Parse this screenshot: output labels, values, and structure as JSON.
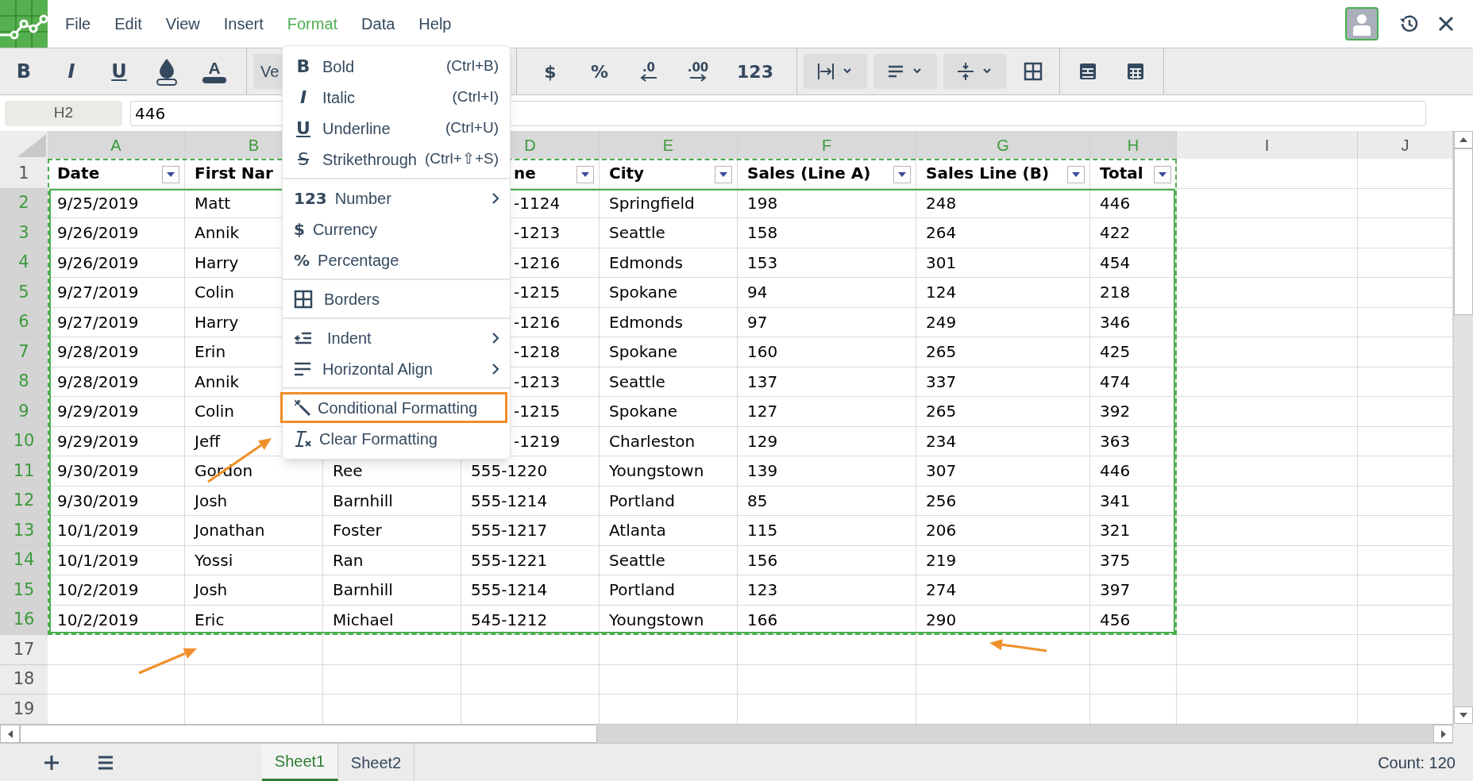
{
  "app_menu": [
    {
      "label": "File",
      "selected": false
    },
    {
      "label": "Edit",
      "selected": false
    },
    {
      "label": "View",
      "selected": false
    },
    {
      "label": "Insert",
      "selected": false
    },
    {
      "label": "Format",
      "selected": true
    },
    {
      "label": "Data",
      "selected": false
    },
    {
      "label": "Help",
      "selected": false
    }
  ],
  "toolbar": {
    "style_buttons": [
      {
        "kind": "bold",
        "label": "B"
      },
      {
        "kind": "italic",
        "label": "I"
      },
      {
        "kind": "underline",
        "label": "U"
      },
      {
        "kind": "fill"
      },
      {
        "kind": "font_color",
        "label": "A"
      }
    ],
    "font_select": "Ve",
    "number_buttons": [
      {
        "kind": "glyph",
        "label": "$"
      },
      {
        "kind": "glyph",
        "label": "%"
      },
      {
        "kind": "decrease",
        "label": ".0"
      },
      {
        "kind": "increase",
        "label": ".00"
      },
      {
        "kind": "glyph",
        "label": "123"
      }
    ]
  },
  "formula_bar": {
    "cell_name": "H2",
    "value": "446"
  },
  "columns": [
    {
      "letter": "A",
      "selected": true
    },
    {
      "letter": "B",
      "selected": true
    },
    {},
    {
      "letter": "D",
      "selected": true
    },
    {
      "letter": "E",
      "selected": true
    },
    {
      "letter": "F",
      "selected": true
    },
    {
      "letter": "G",
      "selected": true
    },
    {
      "letter": "H",
      "selected": true
    },
    {
      "letter": "I",
      "selected": false
    },
    {
      "letter": "J",
      "selected": false
    }
  ],
  "header_row": {
    "number": "1",
    "cells": {
      "A": {
        "text": "Date",
        "filter": true
      },
      "B": {
        "text": "First Nar",
        "filter": false
      },
      "D": {
        "text": "ne",
        "filter": true
      },
      "E": {
        "text": "City",
        "filter": true
      },
      "F": {
        "text": "Sales (Line A)",
        "filter": true
      },
      "G": {
        "text": "Sales Line (B)",
        "filter": true
      },
      "H": {
        "text": "Total",
        "filter": true
      }
    }
  },
  "rows": [
    {
      "number": "2",
      "selected": true,
      "cells": {
        "A": "9/25/2019",
        "B": "Matt",
        "D": "-1124",
        "E": "Springfield",
        "F": "198",
        "G": "248",
        "H": "446"
      }
    },
    {
      "number": "3",
      "selected": true,
      "cells": {
        "A": "9/26/2019",
        "B": "Annik",
        "D": "-1213",
        "E": "Seattle",
        "F": "158",
        "G": "264",
        "H": "422"
      }
    },
    {
      "number": "4",
      "selected": true,
      "cells": {
        "A": "9/26/2019",
        "B": "Harry",
        "D": "-1216",
        "E": "Edmonds",
        "F": "153",
        "G": "301",
        "H": "454"
      }
    },
    {
      "number": "5",
      "selected": true,
      "cells": {
        "A": "9/27/2019",
        "B": "Colin",
        "D": "-1215",
        "E": "Spokane",
        "F": "94",
        "G": "124",
        "H": "218"
      }
    },
    {
      "number": "6",
      "selected": true,
      "cells": {
        "A": "9/27/2019",
        "B": "Harry",
        "D": "-1216",
        "E": "Edmonds",
        "F": "97",
        "G": "249",
        "H": "346"
      }
    },
    {
      "number": "7",
      "selected": true,
      "cells": {
        "A": "9/28/2019",
        "B": "Erin",
        "D": "-1218",
        "E": "Spokane",
        "F": "160",
        "G": "265",
        "H": "425"
      }
    },
    {
      "number": "8",
      "selected": true,
      "cells": {
        "A": "9/28/2019",
        "B": "Annik",
        "D": "-1213",
        "E": "Seattle",
        "F": "137",
        "G": "337",
        "H": "474"
      }
    },
    {
      "number": "9",
      "selected": true,
      "cells": {
        "A": "9/29/2019",
        "B": "Colin",
        "D": "-1215",
        "E": "Spokane",
        "F": "127",
        "G": "265",
        "H": "392"
      }
    },
    {
      "number": "10",
      "selected": true,
      "cells": {
        "A": "9/29/2019",
        "B": "Jeff",
        "D": "-1219",
        "E": "Charleston",
        "F": "129",
        "G": "234",
        "H": "363"
      }
    },
    {
      "number": "11",
      "selected": true,
      "cells": {
        "A": "9/30/2019",
        "B": "Gordon",
        "C": "Ree",
        "D": "555-1220",
        "E": "Youngstown",
        "F": "139",
        "G": "307",
        "H": "446"
      }
    },
    {
      "number": "12",
      "selected": true,
      "cells": {
        "A": "9/30/2019",
        "B": "Josh",
        "C": "Barnhill",
        "D": "555-1214",
        "E": "Portland",
        "F": "85",
        "G": "256",
        "H": "341"
      }
    },
    {
      "number": "13",
      "selected": true,
      "cells": {
        "A": "10/1/2019",
        "B": "Jonathan",
        "C": "Foster",
        "D": "555-1217",
        "E": "Atlanta",
        "F": "115",
        "G": "206",
        "H": "321"
      }
    },
    {
      "number": "14",
      "selected": true,
      "cells": {
        "A": "10/1/2019",
        "B": "Yossi",
        "C": "Ran",
        "D": "555-1221",
        "E": "Seattle",
        "F": "156",
        "G": "219",
        "H": "375"
      }
    },
    {
      "number": "15",
      "selected": true,
      "cells": {
        "A": "10/2/2019",
        "B": "Josh",
        "C": "Barnhill",
        "D": "555-1214",
        "E": "Portland",
        "F": "123",
        "G": "274",
        "H": "397"
      }
    },
    {
      "number": "16",
      "selected": true,
      "cells": {
        "A": "10/2/2019",
        "B": "Eric",
        "C": "Michael",
        "D": "545-1212",
        "E": "Youngstown",
        "F": "166",
        "G": "290",
        "H": "456"
      }
    },
    {
      "number": "17",
      "selected": false
    },
    {
      "number": "18",
      "selected": false
    },
    {
      "number": "19",
      "selected": false
    }
  ],
  "format_menu": {
    "groups": [
      [
        {
          "kind": "bold",
          "glyph": "B",
          "label": "Bold",
          "shortcut": "(Ctrl+B)",
          "submenu": false,
          "selected": false
        },
        {
          "kind": "italic",
          "glyph": "I",
          "label": "Italic",
          "shortcut": "(Ctrl+I)",
          "submenu": false,
          "selected": false
        },
        {
          "kind": "underline",
          "glyph": "U",
          "label": "Underline",
          "shortcut": "(Ctrl+U)",
          "submenu": false,
          "selected": false
        },
        {
          "kind": "strike",
          "glyph": "S",
          "label": "Strikethrough",
          "shortcut": "(Ctrl+⇧+S)",
          "submenu": false,
          "selected": false
        }
      ],
      [
        {
          "kind": "glyph",
          "glyph": "123",
          "label": "Number",
          "submenu": true,
          "selected": false
        },
        {
          "kind": "glyph",
          "glyph": "$",
          "label": "Currency",
          "submenu": false,
          "selected": false
        },
        {
          "kind": "glyph",
          "glyph": "%",
          "label": "Percentage",
          "submenu": false,
          "selected": false
        }
      ],
      [
        {
          "kind": "borders",
          "label": "Borders",
          "submenu": false,
          "selected": false
        }
      ],
      [
        {
          "kind": "indent",
          "label": "Indent",
          "submenu": true,
          "selected": false
        },
        {
          "kind": "align",
          "label": "Horizontal Align",
          "submenu": true,
          "selected": false
        }
      ],
      [
        {
          "kind": "wand",
          "label": "Conditional Formatting",
          "submenu": false,
          "selected": true
        },
        {
          "kind": "clear",
          "label": "Clear Formatting",
          "submenu": false,
          "selected": false
        }
      ]
    ]
  },
  "sheet_tabs": [
    {
      "label": "Sheet1",
      "selected": true
    },
    {
      "label": "Sheet2",
      "selected": false
    }
  ],
  "status": "Count: 120"
}
